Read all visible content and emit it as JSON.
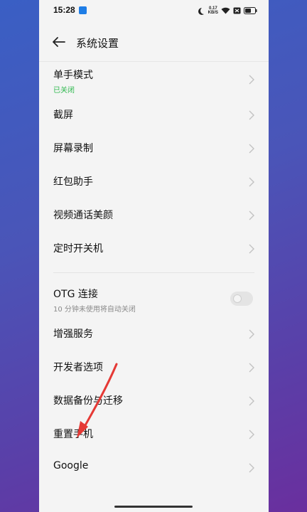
{
  "status_bar": {
    "time": "15:28",
    "net_speed_value": "0.17",
    "net_speed_unit": "KB/S"
  },
  "header": {
    "title": "系统设置"
  },
  "items": [
    {
      "title": "单手模式",
      "subtitle": "已关闭"
    },
    {
      "title": "截屏"
    },
    {
      "title": "屏幕录制"
    },
    {
      "title": "红包助手"
    },
    {
      "title": "视频通话美颜"
    },
    {
      "title": "定时开关机"
    },
    {
      "title": "OTG 连接",
      "subtitle": "10 分钟未使用将自动关闭",
      "toggle_on": false
    },
    {
      "title": "增强服务"
    },
    {
      "title": "开发者选项"
    },
    {
      "title": "数据备份与迁移"
    },
    {
      "title": "重置手机"
    },
    {
      "title": "Google"
    }
  ],
  "colors": {
    "accent_green": "#2db84d",
    "arrow_red": "#e53935"
  },
  "icons": [
    "back-arrow-icon",
    "chevron-right-icon",
    "moon-icon",
    "wifi-icon",
    "sim-icon",
    "battery-icon"
  ]
}
